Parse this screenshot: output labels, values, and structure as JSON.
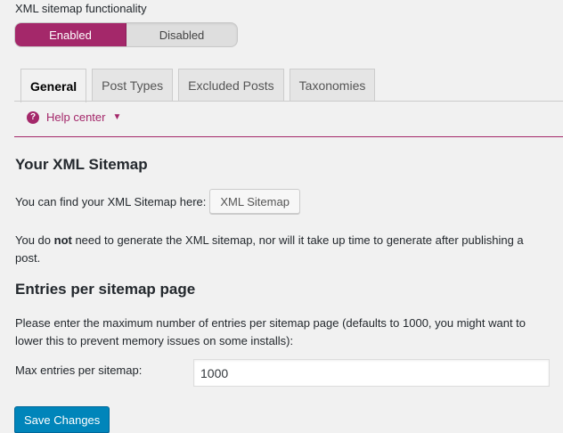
{
  "functionality": {
    "label": "XML sitemap functionality",
    "enabled_label": "Enabled",
    "disabled_label": "Disabled",
    "selected": "Enabled"
  },
  "tabs": [
    {
      "label": "General",
      "active": true
    },
    {
      "label": "Post Types",
      "active": false
    },
    {
      "label": "Excluded Posts",
      "active": false
    },
    {
      "label": "Taxonomies",
      "active": false
    }
  ],
  "help": {
    "label": "Help center",
    "icon": "question-icon"
  },
  "sitemap_section": {
    "title": "Your XML Sitemap",
    "find_text": "You can find your XML Sitemap here:",
    "button_label": "XML Sitemap",
    "note_pre": "You do ",
    "note_bold": "not",
    "note_post": " need to generate the XML sitemap, nor will it take up time to generate after publishing a post."
  },
  "entries_section": {
    "title": "Entries per sitemap page",
    "description": "Please enter the maximum number of entries per sitemap page (defaults to 1000, you might want to lower this to prevent memory issues on some installs):",
    "field_label": "Max entries per sitemap:",
    "field_value": "1000"
  },
  "save_label": "Save Changes",
  "colors": {
    "accent": "#a4286a",
    "primary_button": "#0085ba",
    "background": "#f1f1f1"
  }
}
